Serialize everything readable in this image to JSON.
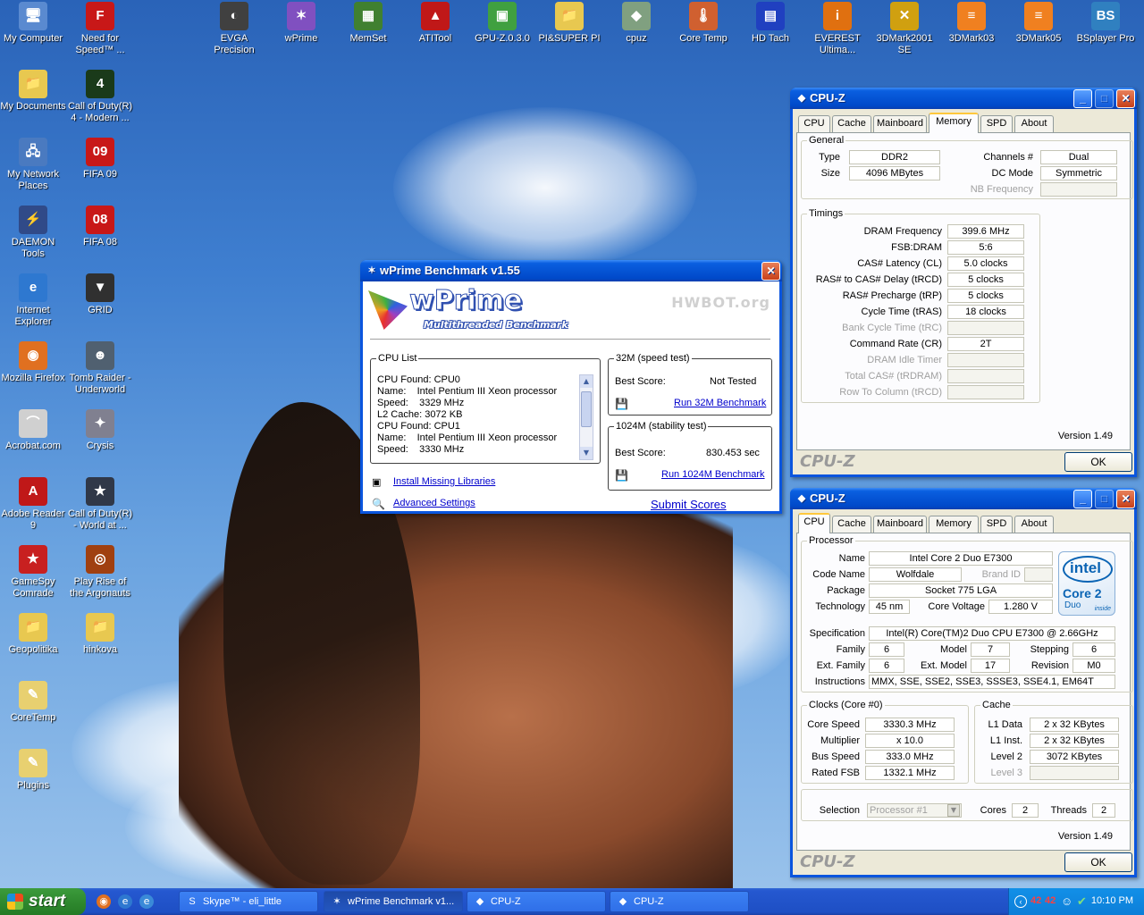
{
  "desktop": {
    "icons_left": [
      {
        "label": "My Computer",
        "glyph": "🖥",
        "color": "#5a8ad0"
      },
      {
        "label": "My Documents",
        "glyph": "📁",
        "color": "#e8c850"
      },
      {
        "label": "My Network Places",
        "glyph": "🖧",
        "color": "#4a7ac0"
      },
      {
        "label": "DAEMON Tools",
        "glyph": "⚡",
        "color": "#304a88"
      },
      {
        "label": "Internet Explorer",
        "glyph": "e",
        "color": "#2e78d0"
      },
      {
        "label": "Mozilla Firefox",
        "glyph": "◉",
        "color": "#e07020"
      },
      {
        "label": "Acrobat.com",
        "glyph": "⌒",
        "color": "#d0d0d0"
      },
      {
        "label": "Adobe Reader 9",
        "glyph": "A",
        "color": "#c01818"
      },
      {
        "label": "GameSpy Comrade",
        "glyph": "★",
        "color": "#c82020"
      },
      {
        "label": "Geopolitika",
        "glyph": "📁",
        "color": "#e8c850"
      },
      {
        "label": "CoreTemp",
        "glyph": "✎",
        "color": "#e8d070"
      },
      {
        "label": "Plugins",
        "glyph": "✎",
        "color": "#e8d070"
      }
    ],
    "icons_col2": [
      {
        "label": "Need for Speed™ ...",
        "glyph": "F",
        "color": "#c81818"
      },
      {
        "label": "Call of Duty(R) 4 - Modern ...",
        "glyph": "4",
        "color": "#1a3a1a"
      },
      {
        "label": "FIFA 09",
        "glyph": "09",
        "color": "#c81818"
      },
      {
        "label": "FIFA 08",
        "glyph": "08",
        "color": "#c81818"
      },
      {
        "label": "GRID",
        "glyph": "▼",
        "color": "#303030"
      },
      {
        "label": "Tomb Raider - Underworld",
        "glyph": "☻",
        "color": "#506070"
      },
      {
        "label": "Crysis",
        "glyph": "✦",
        "color": "#808090"
      },
      {
        "label": "Call of Duty(R) - World at ...",
        "glyph": "★",
        "color": "#303848"
      },
      {
        "label": "Play Rise of the Argonauts",
        "glyph": "◎",
        "color": "#a04010"
      },
      {
        "label": "hinkova",
        "glyph": "📁",
        "color": "#e8c850"
      }
    ],
    "icons_top": [
      {
        "label": "EVGA Precision",
        "glyph": "◐",
        "color": "#404040"
      },
      {
        "label": "wPrime",
        "glyph": "✶",
        "color": "#8050c0"
      },
      {
        "label": "MemSet",
        "glyph": "▦",
        "color": "#408030"
      },
      {
        "label": "ATITool",
        "glyph": "▲",
        "color": "#c01818"
      },
      {
        "label": "GPU-Z.0.3.0",
        "glyph": "▣",
        "color": "#40a040"
      },
      {
        "label": "PI&SUPER PI",
        "glyph": "📁",
        "color": "#e8c850"
      },
      {
        "label": "cpuz",
        "glyph": "◆",
        "color": "#80a080"
      },
      {
        "label": "Core Temp",
        "glyph": "🌡",
        "color": "#d06030"
      },
      {
        "label": "HD Tach",
        "glyph": "▤",
        "color": "#2040c0"
      },
      {
        "label": "EVEREST Ultima...",
        "glyph": "i",
        "color": "#e07010"
      },
      {
        "label": "3DMark2001 SE",
        "glyph": "✕",
        "color": "#d0a010"
      },
      {
        "label": "3DMark03",
        "glyph": "≡",
        "color": "#f08020"
      },
      {
        "label": "3DMark05",
        "glyph": "≡",
        "color": "#f08020"
      },
      {
        "label": "BSplayer Pro",
        "glyph": "BS",
        "color": "#3080c0"
      }
    ]
  },
  "cpuz_memory": {
    "title": "CPU-Z",
    "tabs": [
      "CPU",
      "Cache",
      "Mainboard",
      "Memory",
      "SPD",
      "About"
    ],
    "active_tab": "Memory",
    "general_legend": "General",
    "type_label": "Type",
    "type_value": "DDR2",
    "size_label": "Size",
    "size_value": "4096 MBytes",
    "channels_label": "Channels #",
    "channels_value": "Dual",
    "dcmode_label": "DC Mode",
    "dcmode_value": "Symmetric",
    "nbfreq_label": "NB Frequency",
    "nbfreq_value": "",
    "timings_legend": "Timings",
    "timings": [
      {
        "label": "DRAM Frequency",
        "value": "399.6 MHz",
        "dim": false
      },
      {
        "label": "FSB:DRAM",
        "value": "5:6",
        "dim": false
      },
      {
        "label": "CAS# Latency (CL)",
        "value": "5.0 clocks",
        "dim": false
      },
      {
        "label": "RAS# to CAS# Delay (tRCD)",
        "value": "5 clocks",
        "dim": false
      },
      {
        "label": "RAS# Precharge (tRP)",
        "value": "5 clocks",
        "dim": false
      },
      {
        "label": "Cycle Time (tRAS)",
        "value": "18 clocks",
        "dim": false
      },
      {
        "label": "Bank Cycle Time (tRC)",
        "value": "",
        "dim": true
      },
      {
        "label": "Command Rate (CR)",
        "value": "2T",
        "dim": false
      },
      {
        "label": "DRAM Idle Timer",
        "value": "",
        "dim": true
      },
      {
        "label": "Total CAS# (tRDRAM)",
        "value": "",
        "dim": true
      },
      {
        "label": "Row To Column (tRCD)",
        "value": "",
        "dim": true
      }
    ],
    "version": "Version 1.49",
    "logo": "CPU-Z",
    "ok": "OK"
  },
  "cpuz_cpu": {
    "title": "CPU-Z",
    "tabs": [
      "CPU",
      "Cache",
      "Mainboard",
      "Memory",
      "SPD",
      "About"
    ],
    "active_tab": "CPU",
    "processor_legend": "Processor",
    "name_label": "Name",
    "name_value": "Intel Core 2 Duo E7300",
    "codename_label": "Code Name",
    "codename_value": "Wolfdale",
    "brandid_label": "Brand ID",
    "brandid_value": "",
    "package_label": "Package",
    "package_value": "Socket 775 LGA",
    "tech_label": "Technology",
    "tech_value": "45 nm",
    "voltage_label": "Core Voltage",
    "voltage_value": "1.280 V",
    "spec_label": "Specification",
    "spec_value": "Intel(R) Core(TM)2 Duo CPU     E7300  @ 2.66GHz",
    "family_label": "Family",
    "family_value": "6",
    "model_label": "Model",
    "model_value": "7",
    "stepping_label": "Stepping",
    "stepping_value": "6",
    "extfamily_label": "Ext. Family",
    "extfamily_value": "6",
    "extmodel_label": "Ext. Model",
    "extmodel_value": "17",
    "revision_label": "Revision",
    "revision_value": "M0",
    "instr_label": "Instructions",
    "instr_value": "MMX, SSE, SSE2, SSE3, SSSE3, SSE4.1, EM64T",
    "clocks_legend": "Clocks (Core #0)",
    "corespeed_label": "Core Speed",
    "corespeed_value": "3330.3 MHz",
    "mult_label": "Multiplier",
    "mult_value": "x 10.0",
    "bus_label": "Bus Speed",
    "bus_value": "333.0 MHz",
    "fsb_label": "Rated FSB",
    "fsb_value": "1332.1 MHz",
    "cache_legend": "Cache",
    "l1d_label": "L1 Data",
    "l1d_value": "2 x 32 KBytes",
    "l1i_label": "L1 Inst.",
    "l1i_value": "2 x 32 KBytes",
    "l2_label": "Level 2",
    "l2_value": "3072 KBytes",
    "l3_label": "Level 3",
    "l3_value": "",
    "selection_label": "Selection",
    "selection_value": "Processor #1",
    "cores_label": "Cores",
    "cores_value": "2",
    "threads_label": "Threads",
    "threads_value": "2",
    "intel_word": "intel",
    "intel_brand": "Core 2",
    "intel_sub": "Duo",
    "intel_inside": "inside",
    "version": "Version 1.49",
    "logo": "CPU-Z",
    "ok": "OK"
  },
  "wprime": {
    "title": "wPrime Benchmark v1.55",
    "logo": "wPrime",
    "subtitle": "Multithreaded Benchmark",
    "hwbot": "HWBOT.org",
    "cpulist_legend": "CPU List",
    "cpulist": [
      "CPU Found: CPU0",
      "Name:    Intel Pentium III Xeon processor",
      "Speed:    3329 MHz",
      "L2 Cache: 3072 KB",
      "CPU Found: CPU1",
      "Name:    Intel Pentium III Xeon processor",
      "Speed:    3330 MHz"
    ],
    "t32_legend": "32M (speed test)",
    "t32_best_label": "Best Score:",
    "t32_best_value": "Not Tested",
    "t32_run": "Run 32M Benchmark",
    "t1024_legend": "1024M (stability test)",
    "t1024_best_label": "Best Score:",
    "t1024_best_value": "830.453 sec",
    "t1024_run": "Run 1024M Benchmark",
    "install_libs": "Install Missing Libraries",
    "advanced": "Advanced Settings",
    "submit": "Submit Scores"
  },
  "taskbar": {
    "start": "start",
    "items": [
      {
        "label": "Skype™ - eli_little",
        "icon": "S",
        "active": false
      },
      {
        "label": "wPrime Benchmark v1...",
        "icon": "✶",
        "active": true
      },
      {
        "label": "CPU-Z",
        "icon": "◆",
        "active": false
      },
      {
        "label": "CPU-Z",
        "icon": "◆",
        "active": false
      }
    ],
    "tray_temp1": "42",
    "tray_temp2": "42",
    "clock": "10:10 PM"
  },
  "colors": {
    "xp_blue": "#0a55de",
    "accent_close": "#c7401a",
    "intel_blue": "#0a64b4"
  }
}
